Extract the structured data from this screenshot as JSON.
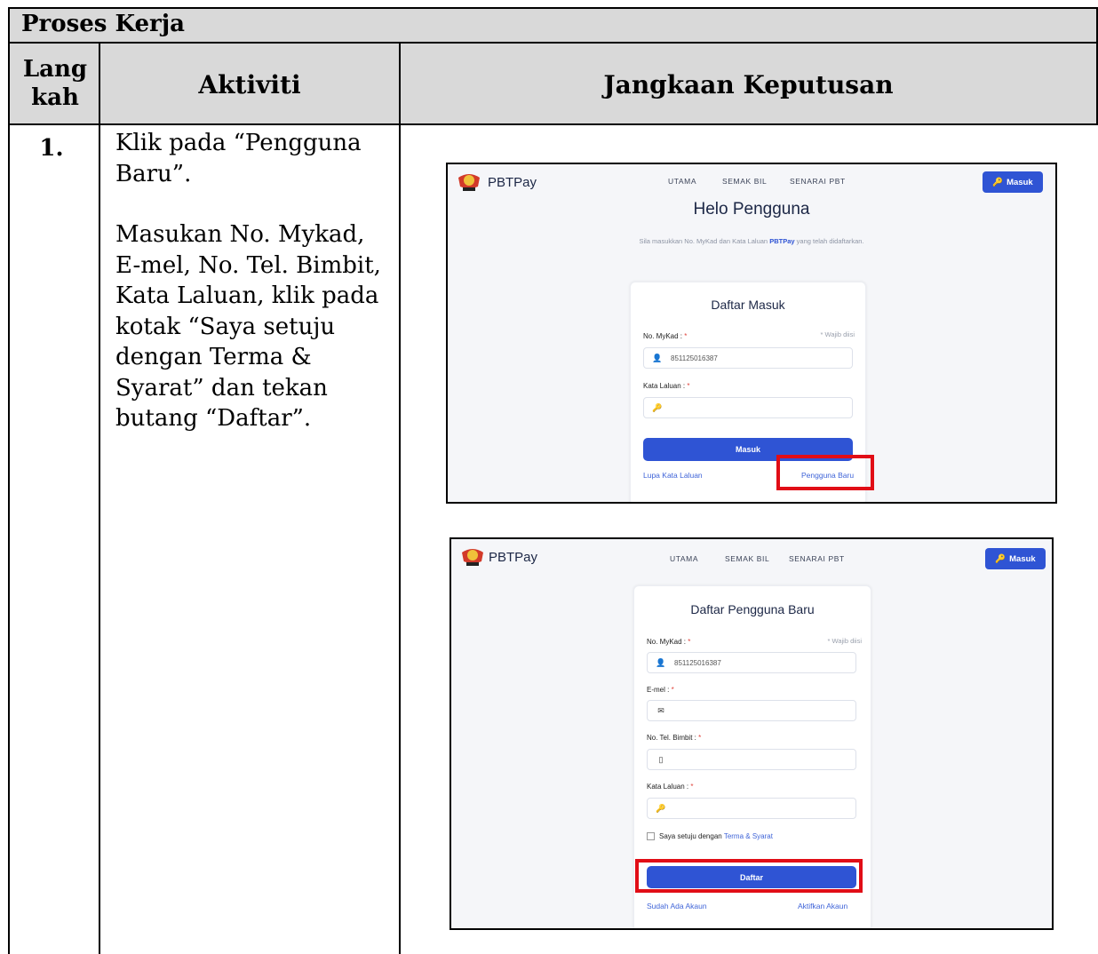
{
  "section_title": "Proses Kerja",
  "headers": {
    "step": "Lang kah",
    "activity": "Aktiviti",
    "result": "Jangkaan Keputusan"
  },
  "step": {
    "number": "1.",
    "paragraphs": [
      "Klik pada “Pengguna Baru”.",
      "Masukan No. Mykad, E-mel, No. Tel. Bimbit, Kata Laluan, klik pada kotak “Saya setuju dengan Terma & Syarat” dan tekan butang “Daftar”."
    ]
  },
  "app": {
    "brand": "PBTPay",
    "nav": [
      "UTAMA",
      "SEMAK BIL",
      "SENARAI PBT"
    ],
    "login_button": "Masuk"
  },
  "login_screen": {
    "heading": "Helo Pengguna",
    "subtitle_pre": "Sila masukkan No. MyKad dan Kata Laluan ",
    "subtitle_brand": "PBTPay",
    "subtitle_post": " yang telah didaftarkan.",
    "card_title": "Daftar Masuk",
    "mykad_label": "No. MyKad :",
    "required_mark": "*",
    "required_hint": "* Wajib diisi",
    "mykad_value": "851125016387",
    "password_label": "Kata Laluan :",
    "submit": "Masuk",
    "forgot_link": "Lupa Kata Laluan",
    "new_user_link": "Pengguna Baru"
  },
  "register_screen": {
    "card_title": "Daftar Pengguna Baru",
    "mykad_label": "No. MyKad :",
    "required_mark": "*",
    "required_hint": "* Wajib diisi",
    "mykad_value": "851125016387",
    "email_label": "E-mel :",
    "phone_label": "No. Tel. Bimbit :",
    "password_label": "Kata Laluan :",
    "terms_pre": "Saya setuju dengan ",
    "terms_link": "Terma & Syarat",
    "submit": "Daftar",
    "have_account_link": "Sudah Ada Akaun",
    "activate_link": "Aktifkan Akaun"
  },
  "colors": {
    "primary": "#2f54d4",
    "highlight": "#e10d16",
    "header_band": "#d9d9d9"
  }
}
